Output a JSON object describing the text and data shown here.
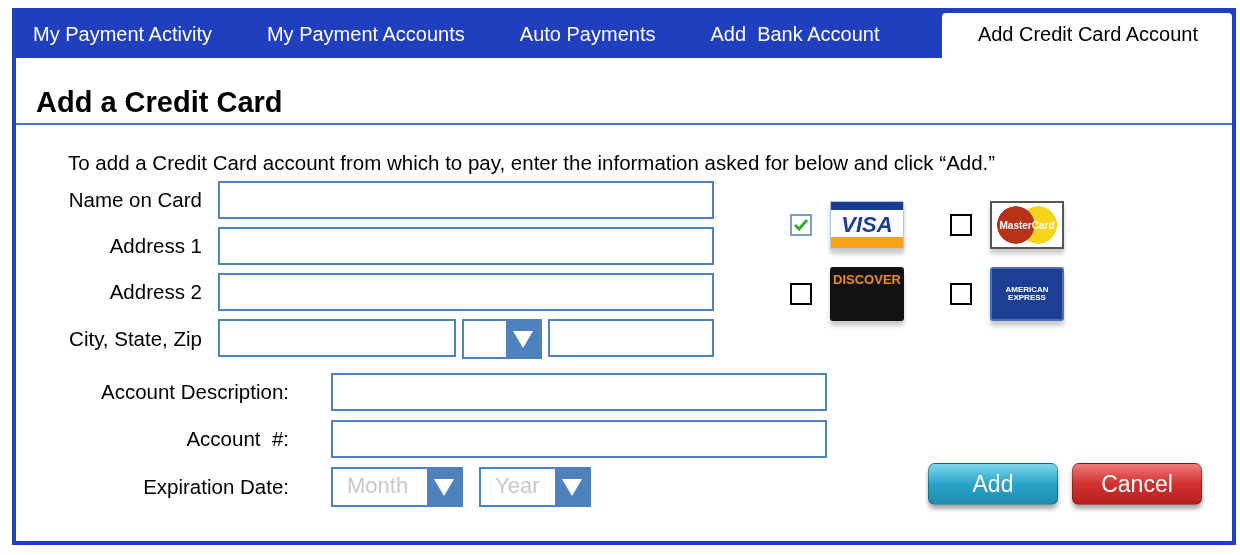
{
  "tabs": [
    {
      "label": "My Payment Activity",
      "selected": false
    },
    {
      "label": "My Payment Accounts",
      "selected": false
    },
    {
      "label": "Auto Payments",
      "selected": false
    },
    {
      "label": "Add  Bank Account",
      "selected": false
    },
    {
      "label": "Add Credit Card Account",
      "selected": true
    }
  ],
  "title": "Add a Credit Card",
  "instruction": "To add a Credit Card account from which to pay, enter the information asked for below and click “Add.”",
  "address_rows": [
    {
      "label": "Name on Card",
      "fields": [
        {
          "kind": "text"
        }
      ]
    },
    {
      "label": "Address 1",
      "fields": [
        {
          "kind": "text"
        }
      ]
    },
    {
      "label": "Address 2",
      "fields": [
        {
          "kind": "text"
        }
      ]
    },
    {
      "label": "City, State, Zip",
      "fields": [
        {
          "kind": "city"
        },
        {
          "kind": "select"
        },
        {
          "kind": "zip"
        }
      ]
    }
  ],
  "cards": [
    {
      "kind": "visa",
      "logo": "VISA",
      "checked": true
    },
    {
      "kind": "mastercard",
      "logo": "MasterCard",
      "checked": false
    },
    {
      "kind": "discover",
      "logo": "DISCOVER",
      "checked": false
    },
    {
      "kind": "amex",
      "logo": "AMERICAN EXPRESS",
      "checked": false
    }
  ],
  "account_rows": [
    {
      "label": "Account Description:"
    },
    {
      "label": "Account  #:"
    }
  ],
  "expiration": {
    "label": "Expiration Date:",
    "selects": [
      {
        "placeholder": "Month"
      },
      {
        "placeholder": "Year"
      }
    ]
  },
  "buttons": [
    {
      "label": "Add",
      "kind": "primary"
    },
    {
      "label": "Cancel",
      "kind": "danger"
    }
  ]
}
